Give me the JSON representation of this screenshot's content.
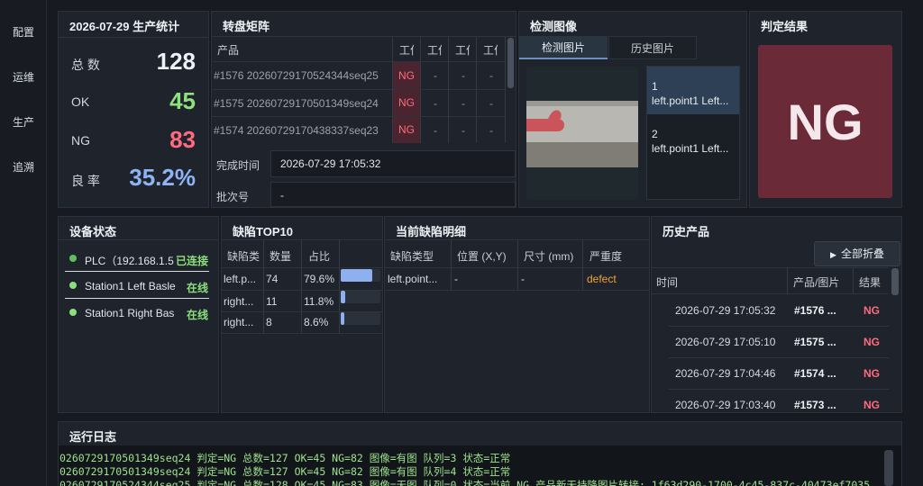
{
  "sidebar": {
    "items": [
      "配置",
      "运维",
      "生产",
      "追溯"
    ]
  },
  "stats": {
    "title": "2026-07-29 生产统计",
    "total_label": "总 数",
    "total_value": "128",
    "ok_label": "OK",
    "ok_value": "45",
    "ng_label": "NG",
    "ng_value": "83",
    "rate_label": "良 率",
    "rate_value": "35.2%"
  },
  "matrix": {
    "title": "转盘矩阵",
    "headers": [
      "产品",
      "工位",
      "工位",
      "工位",
      "工位"
    ],
    "rows": [
      {
        "product": "#1576 20260729170524344seq25",
        "s1": "NG",
        "s2": "-",
        "s3": "-",
        "s4": "-"
      },
      {
        "product": "#1575 20260729170501349seq24",
        "s1": "NG",
        "s2": "-",
        "s3": "-",
        "s4": "-"
      },
      {
        "product": "#1574 20260729170438337seq23",
        "s1": "NG",
        "s2": "-",
        "s3": "-",
        "s4": "-"
      }
    ],
    "finish_label": "完成时间",
    "finish_value": "2026-07-29 17:05:32",
    "batch_label": "批次号",
    "batch_value": "-"
  },
  "detect": {
    "title": "检测图像",
    "tab_current": "检测图片",
    "tab_history": "历史图片",
    "items": [
      {
        "num": "1",
        "label": "left.point1 Left..."
      },
      {
        "num": "2",
        "label": "left.point1 Left..."
      }
    ]
  },
  "judge": {
    "title": "判定结果",
    "result": "NG",
    "color": "#6b2a37"
  },
  "device": {
    "title": "设备状态",
    "items": [
      {
        "name": "PLC（192.168.1.5",
        "status": "已连接",
        "dot": "#5fbf5a"
      },
      {
        "name": "Station1 Left Basle",
        "status": "在线",
        "dot": "#8be07c"
      },
      {
        "name": "Station1 Right Bas",
        "status": "在线",
        "dot": "#8be07c"
      }
    ]
  },
  "top10": {
    "title": "缺陷TOP10",
    "headers": [
      "缺陷类",
      "数量",
      "占比"
    ],
    "rows": [
      {
        "type": "left.p...",
        "count": "74",
        "pct": "79.6%",
        "ratio": 0.796
      },
      {
        "type": "right...",
        "count": "11",
        "pct": "11.8%",
        "ratio": 0.118
      },
      {
        "type": "right...",
        "count": "8",
        "pct": "8.6%",
        "ratio": 0.086
      }
    ]
  },
  "current": {
    "title": "当前缺陷明细",
    "headers": [
      "缺陷类型",
      "位置 (X,Y)",
      "尺寸 (mm)",
      "严重度"
    ],
    "rows": [
      {
        "type": "left.point...",
        "pos": "-",
        "size": "-",
        "severity": "defect"
      }
    ]
  },
  "history": {
    "title": "历史产品",
    "collapse_label": "全部折叠",
    "headers": [
      "时间",
      "产品/图片",
      "结果"
    ],
    "rows": [
      {
        "time": "2026-07-29 17:05:32",
        "product": "#1576 ...",
        "result": "NG"
      },
      {
        "time": "2026-07-29 17:05:10",
        "product": "#1575 ...",
        "result": "NG"
      },
      {
        "time": "2026-07-29 17:04:46",
        "product": "#1574 ...",
        "result": "NG"
      },
      {
        "time": "2026-07-29 17:03:40",
        "product": "#1573 ...",
        "result": "NG"
      }
    ]
  },
  "log": {
    "title": "运行日志",
    "lines": [
      "0260729170501349seq24 判定=NG 总数=127 OK=45 NG=82 图像=有图 队列=3 状态=正常",
      "0260729170501349seq24 判定=NG 总数=127 OK=45 NG=82 图像=有图 队列=4 状态=正常",
      "0260729170524344seq25 判定=NG 总数=128 OK=45 NG=83 图像=无图 队列=0 状态=当前 NG 产品新无持降图片转接: 1f63d290-1700-4c45-837c-40473ef7035"
    ]
  }
}
